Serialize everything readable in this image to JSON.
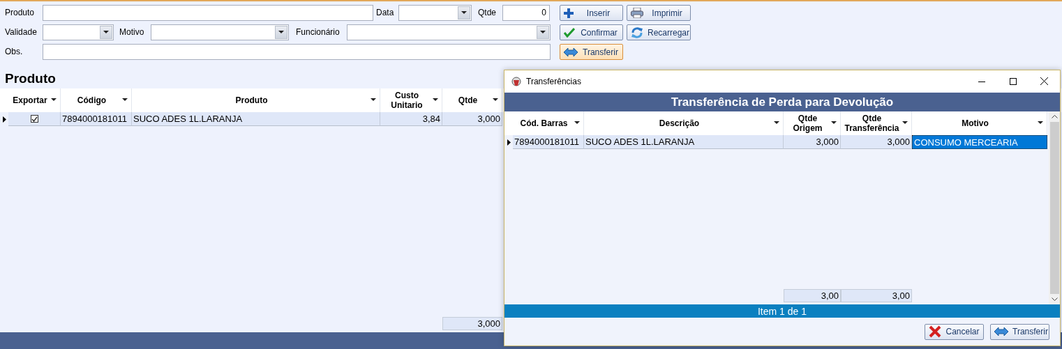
{
  "form": {
    "fields": [
      {
        "label": "Produto",
        "kind": "text"
      },
      {
        "label": "Data",
        "kind": "select"
      },
      {
        "label": "Qtde",
        "kind": "text",
        "value": "0"
      },
      {
        "label": "Validade",
        "kind": "select"
      },
      {
        "label": "Motivo",
        "kind": "select"
      },
      {
        "label": "Funcionário",
        "kind": "select"
      },
      {
        "label": "Obs.",
        "kind": "text"
      }
    ],
    "buttons": [
      {
        "label": "Inserir",
        "kind": "plus",
        "focused": false
      },
      {
        "label": "Imprimir",
        "kind": "print",
        "focused": false
      },
      {
        "label": "Confirmar",
        "kind": "check",
        "focused": false
      },
      {
        "label": "Recarregar",
        "kind": "reload",
        "focused": false
      },
      {
        "label": "Transferir",
        "kind": "transfer",
        "focused": true
      }
    ]
  },
  "main_grid": {
    "title": "Produto",
    "columns": [
      {
        "label": "Exportar",
        "kind": "check"
      },
      {
        "label": "Código",
        "kind": "text"
      },
      {
        "label": "Produto",
        "kind": "text"
      },
      {
        "label": "Custo Unitario",
        "kind": "number"
      },
      {
        "label": "Qtde",
        "kind": "number",
        "total": "3,000"
      }
    ],
    "rows": [
      {
        "current": true,
        "cells": [
          {
            "checked": true
          },
          {
            "text": "7894000181011",
            "selected": false
          },
          {
            "text": "SUCO ADES 1L.LARANJA",
            "selected": false
          },
          {
            "text": "3,84",
            "selected": false
          },
          {
            "text": "3,000",
            "selected": false
          }
        ]
      }
    ]
  },
  "dialog": {
    "title": "Transferências",
    "heading": "Transferência de Perda para Devolução",
    "columns": [
      {
        "label": "Cód. Barras",
        "kind": "text"
      },
      {
        "label": "Descrição",
        "kind": "text"
      },
      {
        "label": "Qtde Origem",
        "kind": "number",
        "total": "3,00"
      },
      {
        "label": "Qtde Transferência",
        "kind": "number",
        "total": "3,00"
      },
      {
        "label": "Motivo",
        "kind": "text"
      }
    ],
    "rows": [
      {
        "current": true,
        "cells": [
          {
            "text": "7894000181011",
            "selected": false
          },
          {
            "text": "SUCO ADES 1L.LARANJA",
            "selected": false
          },
          {
            "text": "3,000",
            "selected": false
          },
          {
            "text": "3,000",
            "selected": false
          },
          {
            "text": "CONSUMO MERCEARIA",
            "selected": true
          }
        ]
      }
    ],
    "status": "Item 1 de 1",
    "buttons": [
      {
        "label": "Cancelar",
        "kind": "cancel",
        "focused": false
      },
      {
        "label": "Transferir",
        "kind": "transfer",
        "focused": false
      }
    ]
  }
}
